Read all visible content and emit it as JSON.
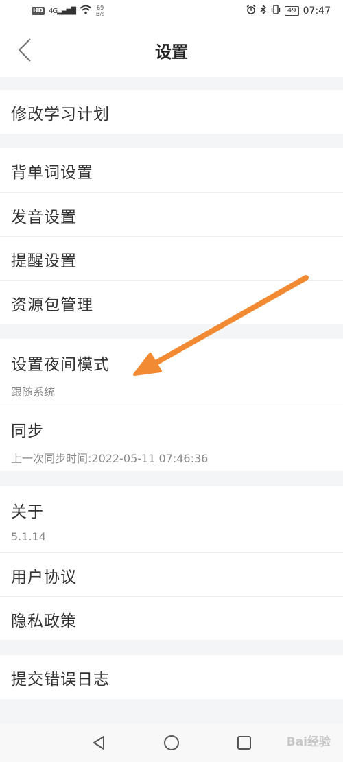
{
  "status": {
    "hd": "HD",
    "signal": "4G",
    "speed_value": "69",
    "speed_unit": "B/s",
    "battery": "49",
    "time": "07:47"
  },
  "header": {
    "title": "设置"
  },
  "groups": [
    {
      "items": [
        {
          "label": "修改学习计划"
        }
      ]
    },
    {
      "items": [
        {
          "label": "背单词设置"
        },
        {
          "label": "发音设置"
        },
        {
          "label": "提醒设置"
        },
        {
          "label": "资源包管理"
        }
      ]
    },
    {
      "items": [
        {
          "label": "设置夜间模式",
          "sub": "跟随系统"
        },
        {
          "label": "同步",
          "sub": "上一次同步时间:2022-05-11 07:46:36"
        }
      ]
    },
    {
      "items": [
        {
          "label": "关于",
          "sub": "5.1.14"
        },
        {
          "label": "用户协议"
        },
        {
          "label": "隐私政策"
        }
      ]
    },
    {
      "items": [
        {
          "label": "提交错误日志"
        }
      ]
    }
  ],
  "watermark": "Bai经验",
  "colors": {
    "arrow": "#f28a33",
    "background": "#f3f5f7"
  },
  "icons": {
    "back": "chevron-left-icon",
    "nav_back": "triangle-back-icon",
    "nav_home": "circle-home-icon",
    "nav_recent": "square-recent-icon"
  }
}
